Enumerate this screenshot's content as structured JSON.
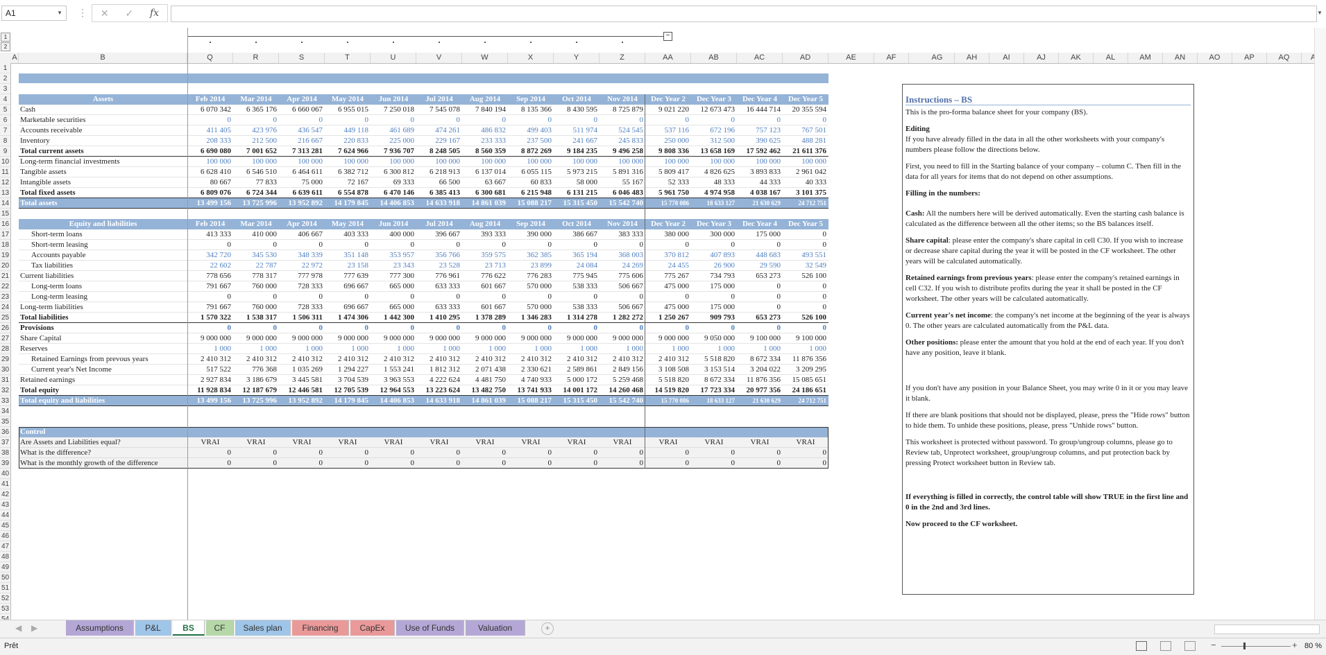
{
  "namebox": "A1",
  "fx_label": "fx",
  "status_text": "Prêt",
  "zoom": "80 %",
  "outline_levels": [
    "1",
    "2"
  ],
  "columns": [
    "A",
    "B",
    "Q",
    "R",
    "S",
    "T",
    "U",
    "V",
    "W",
    "X",
    "Y",
    "Z",
    "AA",
    "AB",
    "AC",
    "AD",
    "AE",
    "AF",
    "AG",
    "AH",
    "AI",
    "AJ",
    "AK",
    "AL",
    "AM",
    "AN",
    "AO",
    "AP",
    "AQ",
    "A"
  ],
  "rows": [
    "1",
    "2",
    "3",
    "4",
    "5",
    "6",
    "7",
    "8",
    "9",
    "10",
    "11",
    "12",
    "13",
    "14",
    "15",
    "16",
    "17",
    "18",
    "19",
    "20",
    "21",
    "22",
    "23",
    "24",
    "25",
    "26",
    "27",
    "28",
    "29",
    "30",
    "31",
    "32",
    "33",
    "34",
    "35",
    "36",
    "37",
    "38",
    "39",
    "40",
    "41",
    "42",
    "43",
    "44",
    "45",
    "46",
    "47",
    "48",
    "49",
    "50",
    "51",
    "52",
    "53",
    "54"
  ],
  "months": [
    "Feb 2014",
    "Mar 2014",
    "Apr 2014",
    "May 2014",
    "Jun 2014",
    "Jul 2014",
    "Aug 2014",
    "Sep 2014",
    "Oct 2014",
    "Nov 2014",
    "Dec Year 2",
    "Dec Year 3",
    "Dec Year 4",
    "Dec Year 5"
  ],
  "assets_header": "Assets",
  "assets": [
    {
      "label": "Cash",
      "style": "normal",
      "values": [
        "6 070 342",
        "6 365 176",
        "6 660 067",
        "6 955 015",
        "7 250 018",
        "7 545 078",
        "7 840 194",
        "8 135 366",
        "8 430 595",
        "8 725 879",
        "9 021 220",
        "12 673 473",
        "16 444 714",
        "20 355 594"
      ]
    },
    {
      "label": "Marketable securities",
      "style": "blue",
      "values": [
        "0",
        "0",
        "0",
        "0",
        "0",
        "0",
        "0",
        "0",
        "0",
        "0",
        "0",
        "0",
        "0",
        "0"
      ]
    },
    {
      "label": "Accounts receivable",
      "style": "blue",
      "values": [
        "411 405",
        "423 976",
        "436 547",
        "449 118",
        "461 689",
        "474 261",
        "486 832",
        "499 403",
        "511 974",
        "524 545",
        "537 116",
        "672 196",
        "757 123",
        "767 501"
      ]
    },
    {
      "label": "Inventory",
      "style": "blue",
      "values": [
        "208 333",
        "212 500",
        "216 667",
        "220 833",
        "225 000",
        "229 167",
        "233 333",
        "237 500",
        "241 667",
        "245 833",
        "250 000",
        "312 500",
        "390 625",
        "488 281"
      ]
    },
    {
      "label": "Total current assets",
      "style": "bold",
      "values": [
        "6 690 080",
        "7 001 652",
        "7 313 281",
        "7 624 966",
        "7 936 707",
        "8 248 505",
        "8 560 359",
        "8 872 269",
        "9 184 235",
        "9 496 258",
        "9 808 336",
        "13 658 169",
        "17 592 462",
        "21 611 376"
      ]
    },
    {
      "label": "Long-term financial investments",
      "style": "blue",
      "values": [
        "100 000",
        "100 000",
        "100 000",
        "100 000",
        "100 000",
        "100 000",
        "100 000",
        "100 000",
        "100 000",
        "100 000",
        "100 000",
        "100 000",
        "100 000",
        "100 000"
      ]
    },
    {
      "label": "Tangible assets",
      "style": "normal",
      "values": [
        "6 628 410",
        "6 546 510",
        "6 464 611",
        "6 382 712",
        "6 300 812",
        "6 218 913",
        "6 137 014",
        "6 055 115",
        "5 973 215",
        "5 891 316",
        "5 809 417",
        "4 826 625",
        "3 893 833",
        "2 961 042"
      ]
    },
    {
      "label": "Intangible assets",
      "style": "normal",
      "values": [
        "80 667",
        "77 833",
        "75 000",
        "72 167",
        "69 333",
        "66 500",
        "63 667",
        "60 833",
        "58 000",
        "55 167",
        "52 333",
        "48 333",
        "44 333",
        "40 333"
      ]
    },
    {
      "label": "Total fixed assets",
      "style": "bold",
      "values": [
        "6 809 076",
        "6 724 344",
        "6 639 611",
        "6 554 878",
        "6 470 146",
        "6 385 413",
        "6 300 681",
        "6 215 948",
        "6 131 215",
        "6 046 483",
        "5 961 750",
        "4 974 958",
        "4 038 167",
        "3 101 375"
      ]
    },
    {
      "label": "Total assets",
      "style": "total",
      "values": [
        "13 499 156",
        "13 725 996",
        "13 952 892",
        "14 179 845",
        "14 406 853",
        "14 633 918",
        "14 861 039",
        "15 088 217",
        "15 315 450",
        "15 542 740",
        "15 770 086",
        "18 633 127",
        "21 630 629",
        "24 712 751"
      ]
    }
  ],
  "liab_header": "Equity and liabilities",
  "liabilities": [
    {
      "label": "Short-term loans",
      "style": "indent",
      "values": [
        "413 333",
        "410 000",
        "406 667",
        "403 333",
        "400 000",
        "396 667",
        "393 333",
        "390 000",
        "386 667",
        "383 333",
        "380 000",
        "300 000",
        "175 000",
        "0"
      ]
    },
    {
      "label": "Short-term leasing",
      "style": "indent",
      "values": [
        "0",
        "0",
        "0",
        "0",
        "0",
        "0",
        "0",
        "0",
        "0",
        "0",
        "0",
        "0",
        "0",
        "0"
      ]
    },
    {
      "label": "Accounts payable",
      "style": "indentblue",
      "values": [
        "342 720",
        "345 530",
        "348 339",
        "351 148",
        "353 957",
        "356 766",
        "359 575",
        "362 385",
        "365 194",
        "368 003",
        "370 812",
        "407 893",
        "448 683",
        "493 551"
      ]
    },
    {
      "label": "Tax liabilities",
      "style": "indentblue",
      "values": [
        "22 602",
        "22 787",
        "22 972",
        "23 158",
        "23 343",
        "23 528",
        "23 713",
        "23 899",
        "24 084",
        "24 269",
        "24 455",
        "26 900",
        "29 590",
        "32 549"
      ]
    },
    {
      "label": "Current liabilities",
      "style": "normal",
      "values": [
        "778 656",
        "778 317",
        "777 978",
        "777 639",
        "777 300",
        "776 961",
        "776 622",
        "776 283",
        "775 945",
        "775 606",
        "775 267",
        "734 793",
        "653 273",
        "526 100"
      ]
    },
    {
      "label": "Long-term loans",
      "style": "indent",
      "values": [
        "791 667",
        "760 000",
        "728 333",
        "696 667",
        "665 000",
        "633 333",
        "601 667",
        "570 000",
        "538 333",
        "506 667",
        "475 000",
        "175 000",
        "0",
        "0"
      ]
    },
    {
      "label": "Long-term leasing",
      "style": "indent",
      "values": [
        "0",
        "0",
        "0",
        "0",
        "0",
        "0",
        "0",
        "0",
        "0",
        "0",
        "0",
        "0",
        "0",
        "0"
      ]
    },
    {
      "label": "Long-term liabilities",
      "style": "normal",
      "values": [
        "791 667",
        "760 000",
        "728 333",
        "696 667",
        "665 000",
        "633 333",
        "601 667",
        "570 000",
        "538 333",
        "506 667",
        "475 000",
        "175 000",
        "0",
        "0"
      ]
    },
    {
      "label": "Total liabilities",
      "style": "bold",
      "values": [
        "1 570 322",
        "1 538 317",
        "1 506 311",
        "1 474 306",
        "1 442 300",
        "1 410 295",
        "1 378 289",
        "1 346 283",
        "1 314 278",
        "1 282 272",
        "1 250 267",
        "909 793",
        "653 273",
        "526 100"
      ]
    },
    {
      "label": "Provisions",
      "style": "boldblue",
      "values": [
        "0",
        "0",
        "0",
        "0",
        "0",
        "0",
        "0",
        "0",
        "0",
        "0",
        "0",
        "0",
        "0",
        "0"
      ]
    },
    {
      "label": "Share Capital",
      "style": "normal",
      "values": [
        "9 000 000",
        "9 000 000",
        "9 000 000",
        "9 000 000",
        "9 000 000",
        "9 000 000",
        "9 000 000",
        "9 000 000",
        "9 000 000",
        "9 000 000",
        "9 000 000",
        "9 050 000",
        "9 100 000",
        "9 100 000"
      ]
    },
    {
      "label": "Reserves",
      "style": "blue",
      "values": [
        "1 000",
        "1 000",
        "1 000",
        "1 000",
        "1 000",
        "1 000",
        "1 000",
        "1 000",
        "1 000",
        "1 000",
        "1 000",
        "1 000",
        "1 000",
        "1 000"
      ]
    },
    {
      "label": "Retained Earnings from prevous years",
      "style": "indent",
      "values": [
        "2 410 312",
        "2 410 312",
        "2 410 312",
        "2 410 312",
        "2 410 312",
        "2 410 312",
        "2 410 312",
        "2 410 312",
        "2 410 312",
        "2 410 312",
        "2 410 312",
        "5 518 820",
        "8 672 334",
        "11 876 356"
      ]
    },
    {
      "label": "Current year's Net Income",
      "style": "indent",
      "values": [
        "517 522",
        "776 368",
        "1 035 269",
        "1 294 227",
        "1 553 241",
        "1 812 312",
        "2 071 438",
        "2 330 621",
        "2 589 861",
        "2 849 156",
        "3 108 508",
        "3 153 514",
        "3 204 022",
        "3 209 295"
      ]
    },
    {
      "label": "Retained earnings",
      "style": "normal",
      "values": [
        "2 927 834",
        "3 186 679",
        "3 445 581",
        "3 704 539",
        "3 963 553",
        "4 222 624",
        "4 481 750",
        "4 740 933",
        "5 000 172",
        "5 259 468",
        "5 518 820",
        "8 672 334",
        "11 876 356",
        "15 085 651"
      ]
    },
    {
      "label": "Total equity",
      "style": "bold",
      "values": [
        "11 928 834",
        "12 187 679",
        "12 446 581",
        "12 705 539",
        "12 964 553",
        "13 223 624",
        "13 482 750",
        "13 741 933",
        "14 001 172",
        "14 260 468",
        "14 519 820",
        "17 723 334",
        "20 977 356",
        "24 186 651"
      ]
    },
    {
      "label": "Total equity and liabilities",
      "style": "total",
      "values": [
        "13 499 156",
        "13 725 996",
        "13 952 892",
        "14 179 845",
        "14 406 853",
        "14 633 918",
        "14 861 039",
        "15 088 217",
        "15 315 450",
        "15 542 740",
        "15 770 086",
        "18 633 127",
        "21 630 629",
        "24 712 751"
      ]
    }
  ],
  "control_header": "Control",
  "control": [
    {
      "label": "Are Assets and Liabilities equal?",
      "values": [
        "VRAI",
        "VRAI",
        "VRAI",
        "VRAI",
        "VRAI",
        "VRAI",
        "VRAI",
        "VRAI",
        "VRAI",
        "VRAI",
        "VRAI",
        "VRAI",
        "VRAI",
        "VRAI"
      ]
    },
    {
      "label": "What is the difference?",
      "values": [
        "0",
        "0",
        "0",
        "0",
        "0",
        "0",
        "0",
        "0",
        "0",
        "0",
        "0",
        "0",
        "0",
        "0"
      ]
    },
    {
      "label": "What is the monthly growth of the difference",
      "values": [
        "0",
        "0",
        "0",
        "0",
        "0",
        "0",
        "0",
        "0",
        "0",
        "0",
        "0",
        "0",
        "0",
        "0"
      ]
    }
  ],
  "instructions": {
    "title": "Instructions – BS",
    "intro": "This is the pro-forma balance sheet for your company (BS).",
    "editing_h": "Editing",
    "editing_p": "If you have already filled in the data in all the other worksheets with your company's numbers please follow the directions below.",
    "first_p": "First, you need to fill in the Starting balance of your company – column C. Then fill in the data for all years for items that do not depend on other assumptions.",
    "filling_h": "Filling in the numbers:",
    "cash_b": "Cash:",
    "cash_p": " All the numbers here will be derived automatically. Even the starting cash balance is calculated as the difference between all the other items; so the BS balances itself.",
    "share_b": "Share capital",
    "share_p": ": please enter the company's share capital in cell C30. If you wish to increase or decrease share capital during the year it will be posted in the CF worksheet. The other years will be calculated automatically.",
    "ret_b": "Retained earnings from previous years",
    "ret_p": ": please enter the company's retained earnings in cell C32. If you wish to distribute profits during the year it shall be posted in the CF worksheet. The other years will be calculated automatically.",
    "ni_b": "Current year's net income",
    "ni_p": ": the company's net income at the beginning of the year is always 0. The other years are calculated automatically from the P&L data.",
    "other_b": "Other positions:",
    "other_p": " please enter the amount that you hold at the end of each year. If you don't have any position, leave it blank.",
    "blank_p": "If you don't have any position in your Balance Sheet, you may write 0 in it or you may leave it blank.",
    "hide_p": "If there are blank positions that should not be displayed, please, press the \"Hide rows\" button to hide them. To unhide these positions, please, press \"Unhide rows\" button.",
    "protect_p": "This worksheet is protected without password. To group/ungroup columns, please go to Review tab, Unprotect worksheet, group/ungroup columns, and put protection back by pressing Protect worksheet button in Review tab.",
    "control_b": "If everything is filled in correctly, the control table will show TRUE in the first line and 0 in the 2nd and 3rd lines.",
    "proceed_b": "Now proceed to the CF worksheet."
  },
  "tabs": [
    {
      "label": "Assumptions",
      "color": "#b4a7d6"
    },
    {
      "label": "P&L",
      "color": "#9fc5e8"
    },
    {
      "label": "BS",
      "color": "#ffffff"
    },
    {
      "label": "CF",
      "color": "#b6d7a8"
    },
    {
      "label": "Sales plan",
      "color": "#9fc5e8"
    },
    {
      "label": "Financing",
      "color": "#ea9999"
    },
    {
      "label": "CapEx",
      "color": "#ea9999"
    },
    {
      "label": "Use of Funds",
      "color": "#b4a7d6"
    },
    {
      "label": "Valuation",
      "color": "#b4a7d6"
    }
  ]
}
